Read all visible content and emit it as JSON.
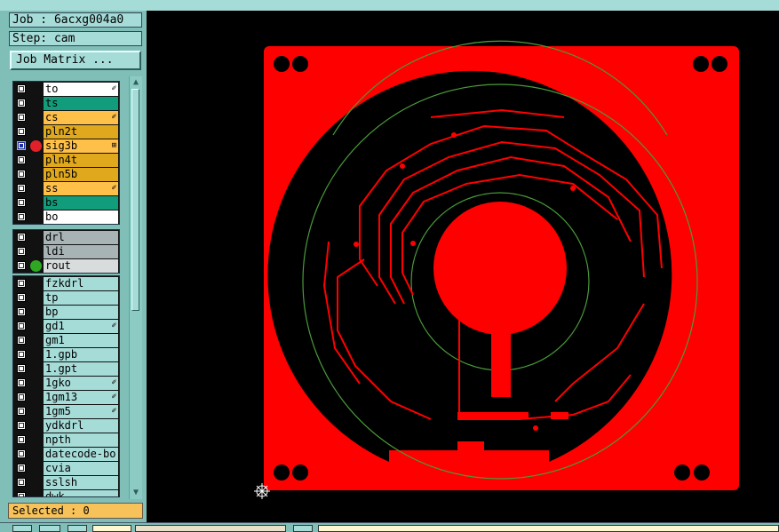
{
  "job_label": "Job : 6acxg004a0",
  "step_label": "Step: cam",
  "job_matrix_button": "Job Matrix ...",
  "layer_groups": [
    [
      {
        "name": "to",
        "color": "#ffffff",
        "mark": "✐"
      },
      {
        "name": "ts",
        "color": "#119d7c",
        "mark": ""
      },
      {
        "name": "cs",
        "color": "#ffc04a",
        "mark": "✐"
      },
      {
        "name": "pln2t",
        "color": "#e0a81c",
        "mark": ""
      },
      {
        "name": "sig3b",
        "color": "#ffc04a",
        "mark": "⊞",
        "selected": true,
        "dot": "#e2202a"
      },
      {
        "name": "pln4t",
        "color": "#e0a81c",
        "mark": ""
      },
      {
        "name": "pln5b",
        "color": "#e0a81c",
        "mark": ""
      },
      {
        "name": "ss",
        "color": "#ffc04a",
        "mark": "✐"
      },
      {
        "name": "bs",
        "color": "#119d7c",
        "mark": ""
      },
      {
        "name": "bo",
        "color": "#ffffff",
        "mark": ""
      }
    ],
    [
      {
        "name": "drl",
        "color": "#a7b3b5",
        "mark": ""
      },
      {
        "name": "ldi",
        "color": "#a7b3b5",
        "mark": ""
      },
      {
        "name": "rout",
        "color": "#d8dcdc",
        "mark": "",
        "dot": "#2ea822"
      }
    ],
    [
      {
        "name": "fzkdrl",
        "color": "#a6dcd8",
        "mark": ""
      },
      {
        "name": "tp",
        "color": "#a6dcd8",
        "mark": ""
      },
      {
        "name": "bp",
        "color": "#a6dcd8",
        "mark": ""
      },
      {
        "name": "gd1",
        "color": "#a6dcd8",
        "mark": "✐"
      },
      {
        "name": "gm1",
        "color": "#a6dcd8",
        "mark": ""
      },
      {
        "name": "1.gpb",
        "color": "#a6dcd8",
        "mark": ""
      },
      {
        "name": "1.gpt",
        "color": "#a6dcd8",
        "mark": ""
      },
      {
        "name": "1gko",
        "color": "#a6dcd8",
        "mark": "✐"
      },
      {
        "name": "1gm13",
        "color": "#a6dcd8",
        "mark": "✐"
      },
      {
        "name": "1gm5",
        "color": "#a6dcd8",
        "mark": "✐"
      },
      {
        "name": "ydkdrl",
        "color": "#a6dcd8",
        "mark": ""
      },
      {
        "name": "npth",
        "color": "#a6dcd8",
        "mark": ""
      },
      {
        "name": "datecode-bo",
        "color": "#a6dcd8",
        "mark": ""
      },
      {
        "name": "cvia",
        "color": "#a6dcd8",
        "mark": ""
      },
      {
        "name": "sslsh",
        "color": "#a6dcd8",
        "mark": ""
      },
      {
        "name": "dwk",
        "color": "#a6dcd8",
        "mark": ""
      }
    ]
  ],
  "selected_label": "Selected : 0",
  "colors": {
    "board_fill": "#ff0000",
    "trace_color": "#ff0000",
    "outline_color": "#4a9a3a",
    "background": "#000000"
  },
  "scroll_up_icon": "arrow-up-icon",
  "scroll_down_icon": "arrow-down-icon",
  "cursor_icon": "crosshair-target-icon"
}
